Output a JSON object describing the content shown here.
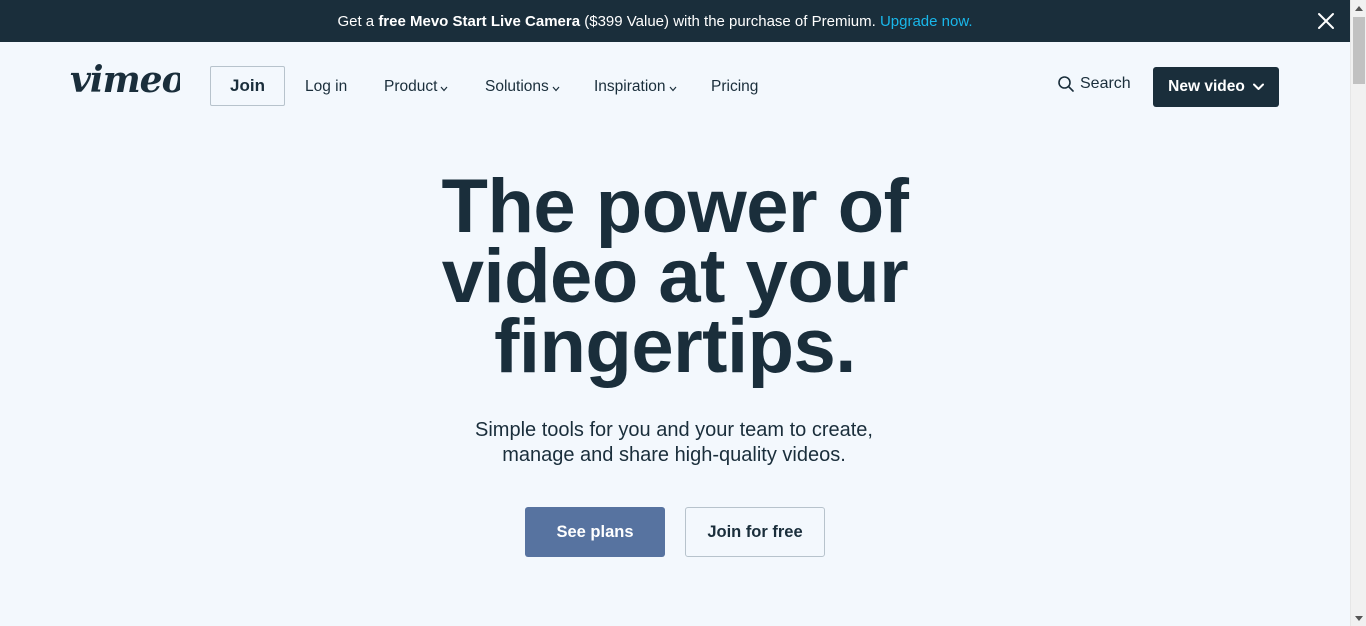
{
  "promo": {
    "prefix": "Get a ",
    "bold": "free Mevo Start Live Camera",
    "suffix": " ($399 Value) with the purchase of Premium. ",
    "link": "Upgrade now."
  },
  "nav": {
    "logo": "vimeo",
    "join": "Join",
    "login": "Log in",
    "product": "Product",
    "solutions": "Solutions",
    "inspiration": "Inspiration",
    "pricing": "Pricing",
    "search": "Search",
    "new_video": "New video"
  },
  "hero": {
    "title_line1": "The power of",
    "title_line2": "video at your",
    "title_line3": "fingertips.",
    "subtitle_line1": "Simple tools for you and your team to create,",
    "subtitle_line2": "manage and share high-quality videos.",
    "see_plans": "See plans",
    "join_free": "Join for free"
  },
  "colors": {
    "navy": "#1a2e3b",
    "accent_link": "#19b7ea",
    "primary_button": "#5773a0",
    "page_bg": "#f3f8fd"
  }
}
